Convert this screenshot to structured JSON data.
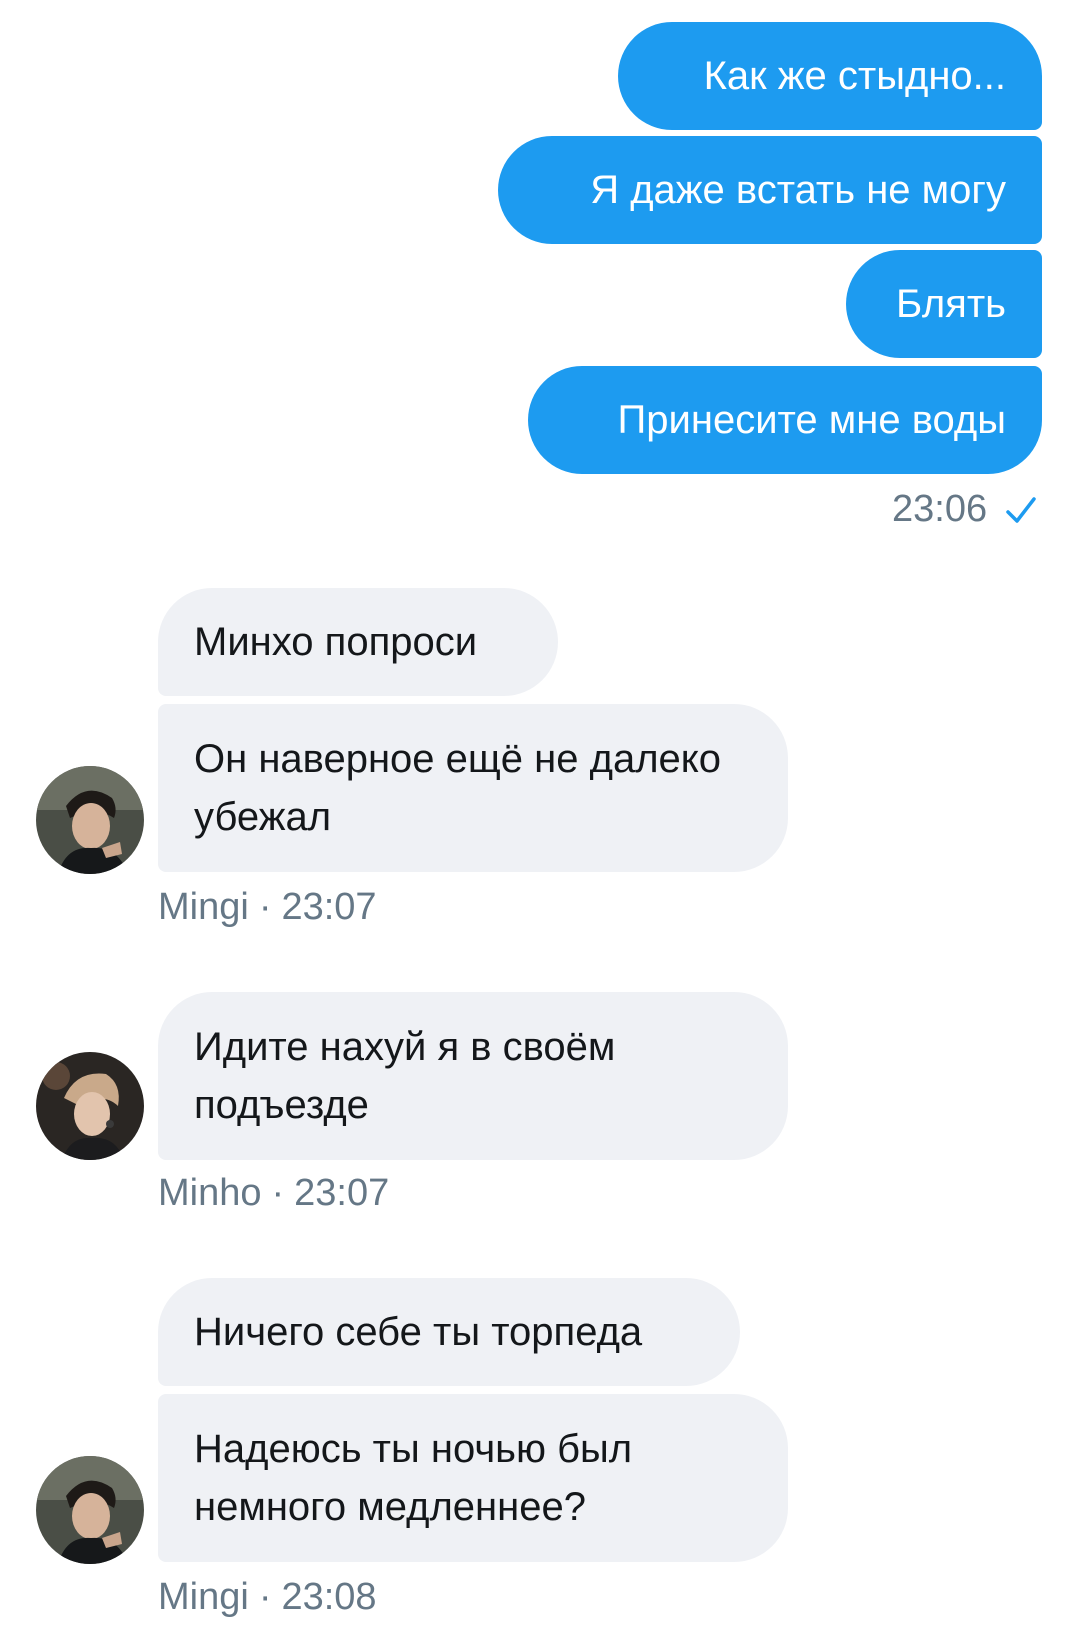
{
  "outgoing": {
    "messages": [
      "Как же стыдно...",
      "Я даже встать не могу",
      "Блять",
      "Принесите мне воды"
    ],
    "time": "23:06",
    "status_icon": "check-icon",
    "bubble_color": "#1d9bf0"
  },
  "incoming": [
    {
      "sender": "Mingi",
      "time": "23:07",
      "avatar_icon": "mingi-avatar",
      "messages": [
        "Минхо попроси",
        "Он наверное ещё не далеко убежал"
      ]
    },
    {
      "sender": "Minho",
      "time": "23:07",
      "avatar_icon": "minho-avatar",
      "messages": [
        "Идите нахуй я в своём подъезде"
      ]
    },
    {
      "sender": "Mingi",
      "time": "23:08",
      "avatar_icon": "mingi-avatar",
      "messages": [
        "Ничего себе ты торпеда",
        "Надеюсь ты ночью был немного медленнее?"
      ]
    }
  ],
  "meta_separator": "·"
}
